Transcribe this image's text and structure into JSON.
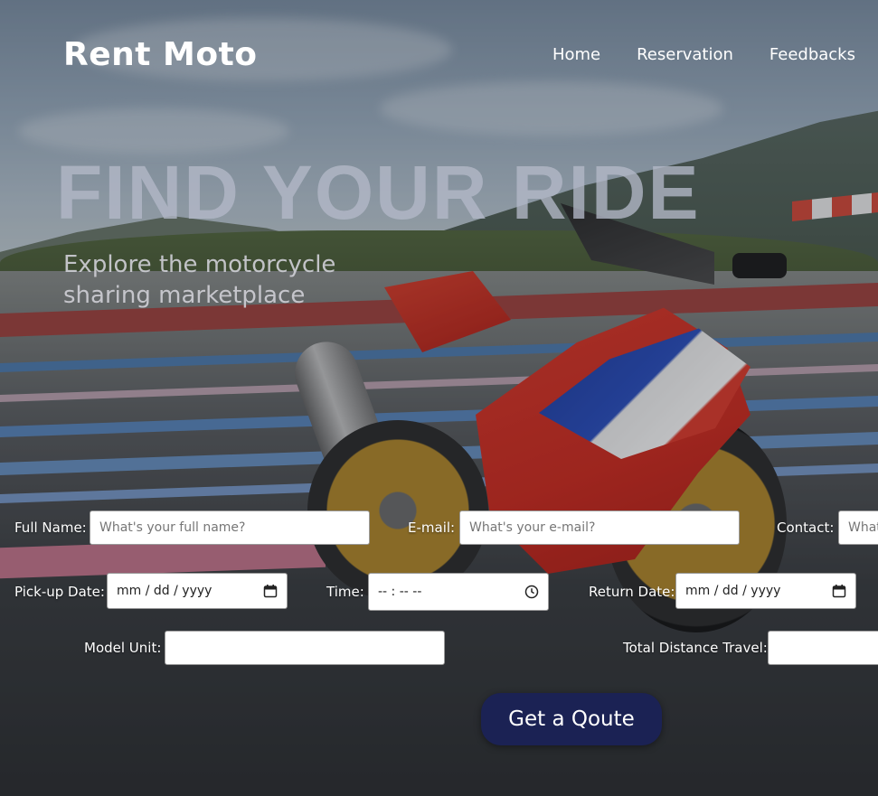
{
  "header": {
    "brand": "Rent Moto",
    "nav": [
      "Home",
      "Reservation",
      "Feedbacks"
    ]
  },
  "hero": {
    "title": "FIND YOUR RIDE",
    "subtitle": "Explore the motorcycle sharing marketplace"
  },
  "form": {
    "full_name": {
      "label": "Full Name:",
      "placeholder": "What's your full name?"
    },
    "email": {
      "label": "E-mail:",
      "placeholder": "What's your e-mail?"
    },
    "contact": {
      "label": "Contact:",
      "placeholder": "What"
    },
    "pickup_date": {
      "label": "Pick-up Date:",
      "value": "mm / dd / yyyy"
    },
    "time": {
      "label": "Time:",
      "value": "-- : --  --"
    },
    "return_date": {
      "label": "Return Date:",
      "value": "mm / dd / yyyy"
    },
    "model_unit": {
      "label": "Model Unit:",
      "value": ""
    },
    "total_distance": {
      "label": "Total Distance Travel:",
      "value": ""
    },
    "submit_label": "Get a Qoute"
  },
  "icons": {
    "date": "calendar-icon",
    "time": "clock-icon"
  },
  "colors": {
    "button_bg": "#1b2254",
    "hero_title": "#b4b8c8"
  }
}
